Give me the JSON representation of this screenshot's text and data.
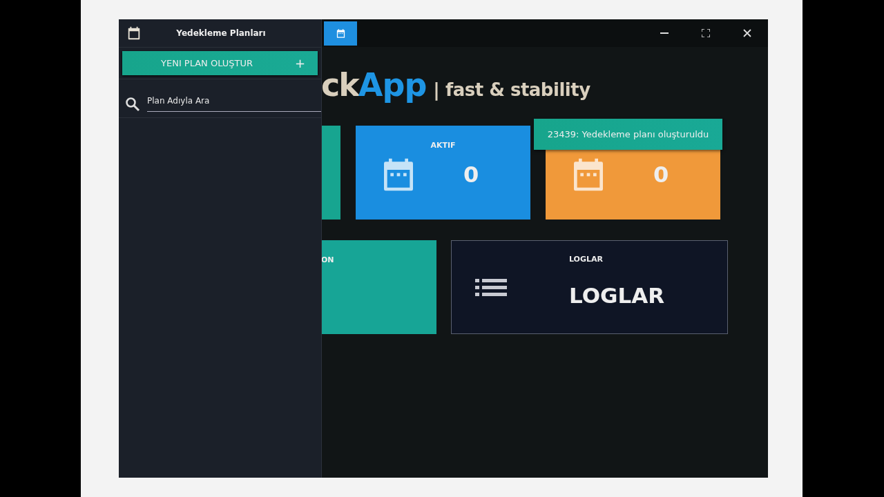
{
  "sidebar": {
    "title": "Yedekleme Planları",
    "new_button": {
      "label": "YENI PLAN OLUŞTUR",
      "icon": "+"
    },
    "search": {
      "placeholder": "Plan Adıyla Ara"
    }
  },
  "logo": {
    "part_1": "ck",
    "part_2": "App",
    "tagline": "| fast & stability"
  },
  "tile_rows": [
    {
      "tiles": [
        {
          "kind": "blank",
          "color": "#17a590"
        },
        {
          "kind": "stat",
          "label": "AKTIF",
          "count": "0",
          "color": "#1a8ee0"
        },
        {
          "kind": "stat",
          "count": "0",
          "color": "#f0993a"
        }
      ]
    },
    {
      "tiles": [
        {
          "kind": "label",
          "label": "ON",
          "color": "#17a596"
        },
        {
          "kind": "log",
          "label": "LOGLAR",
          "value": "LOGLAR",
          "color": "#0f1525"
        }
      ]
    }
  ],
  "toast": {
    "message": "23439: Yedekleme planı oluşturuldu"
  }
}
